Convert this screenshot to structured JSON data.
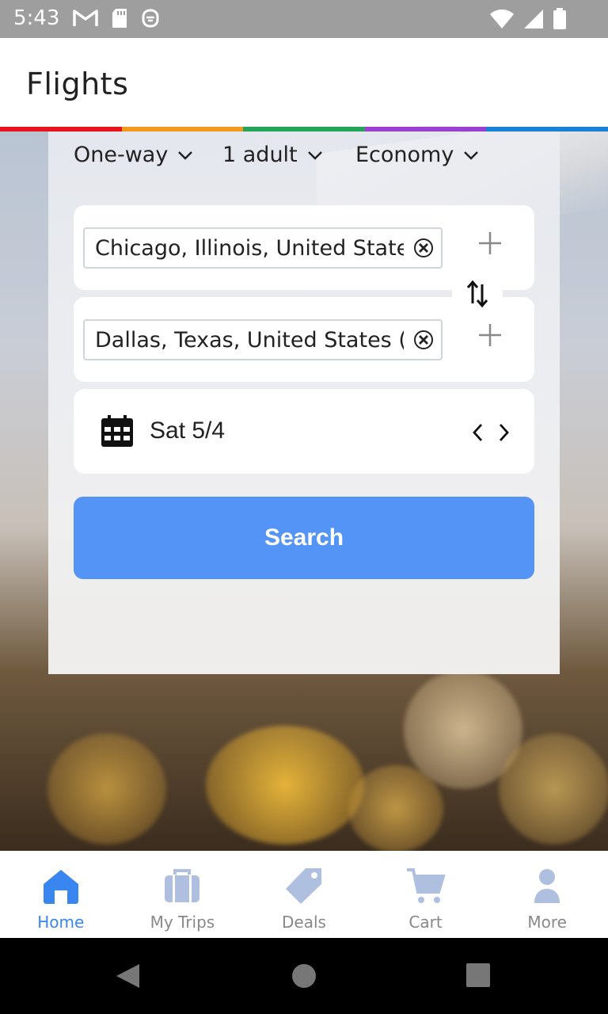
{
  "status_bar": {
    "time": "5:43",
    "left_icons": [
      "gmail-icon",
      "sd-card-icon",
      "assistant-icon"
    ],
    "right_icons": [
      "wifi-icon",
      "signal-icon",
      "battery-icon"
    ]
  },
  "app_bar": {
    "title": "Flights",
    "rainbow_colors": [
      "#e8141c",
      "#f29a1d",
      "#23a45a",
      "#9b3fd1",
      "#1a82d6"
    ]
  },
  "trip_options": {
    "trip_type": "One-way",
    "passengers": "1 adult",
    "cabin_class": "Economy"
  },
  "origin": {
    "value": "Chicago, Illinois, United States…"
  },
  "destination": {
    "value": "Dallas, Texas, United States (…"
  },
  "date": {
    "value": "Sat 5/4"
  },
  "search_button": {
    "label": "Search",
    "color": "#5494f6"
  },
  "bottom_nav": {
    "items": [
      {
        "label": "Home",
        "icon": "home-icon",
        "active": true
      },
      {
        "label": "My Trips",
        "icon": "briefcase-icon",
        "active": false
      },
      {
        "label": "Deals",
        "icon": "tag-icon",
        "active": false
      },
      {
        "label": "Cart",
        "icon": "cart-icon",
        "active": false
      },
      {
        "label": "More",
        "icon": "person-icon",
        "active": false
      }
    ],
    "active_color": "#3a86f0",
    "inactive_icon_color": "#aebfe0"
  }
}
